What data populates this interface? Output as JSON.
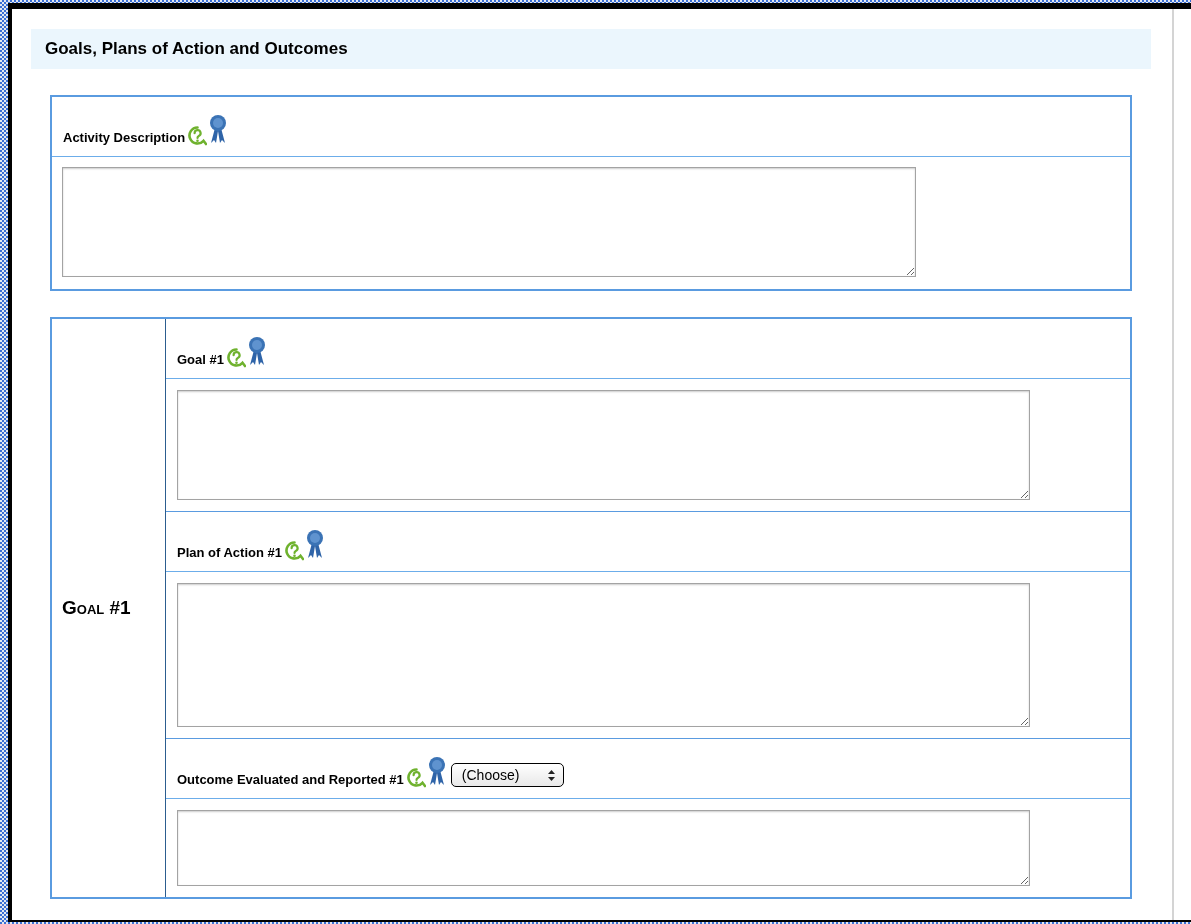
{
  "section": {
    "title": "Goals, Plans of Action and Outcomes"
  },
  "activity": {
    "label": "Activity Description"
  },
  "goal": {
    "label": "Goal #1",
    "fields": [
      {
        "label": "Goal #1",
        "kind": "text"
      },
      {
        "label": "Plan of Action #1",
        "kind": "text"
      },
      {
        "label": "Outcome Evaluated and Reported #1",
        "kind": "choice",
        "select": {
          "value": "(Choose)"
        }
      }
    ]
  }
}
